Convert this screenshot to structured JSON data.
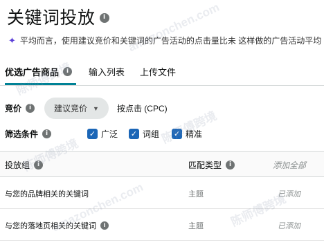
{
  "header": {
    "title": "关键词投放"
  },
  "notice": {
    "text": "平均而言，使用建议竞价和关键词的广告活动的点击量比未 这样做的广告活动平均"
  },
  "tabs": [
    {
      "label": "优选广告商品",
      "active": true
    },
    {
      "label": "输入列表",
      "active": false
    },
    {
      "label": "上传文件",
      "active": false
    }
  ],
  "bid": {
    "label": "竞价",
    "dropdown_value": "建议竞价",
    "description": "按点击 (CPC)"
  },
  "filter": {
    "label": "筛选条件",
    "options": [
      {
        "label": "广泛",
        "checked": true
      },
      {
        "label": "词组",
        "checked": true
      },
      {
        "label": "精准",
        "checked": true
      }
    ]
  },
  "table": {
    "headers": {
      "group": "投放组",
      "match_type": "匹配类型",
      "action": "添加全部"
    },
    "rows": [
      {
        "group": "与您的品牌相关的关键词",
        "match_type": "主题",
        "status": "已添加"
      },
      {
        "group": "与您的落地页相关的关键词",
        "match_type": "主题",
        "status": "已添加"
      }
    ]
  },
  "watermark": {
    "cn": "陈师傅跨境",
    "en": "amazonchen.com"
  },
  "colors": {
    "accent": "#008296",
    "checkbox": "#1b66b7",
    "sparkle": "#5b3fd8"
  }
}
